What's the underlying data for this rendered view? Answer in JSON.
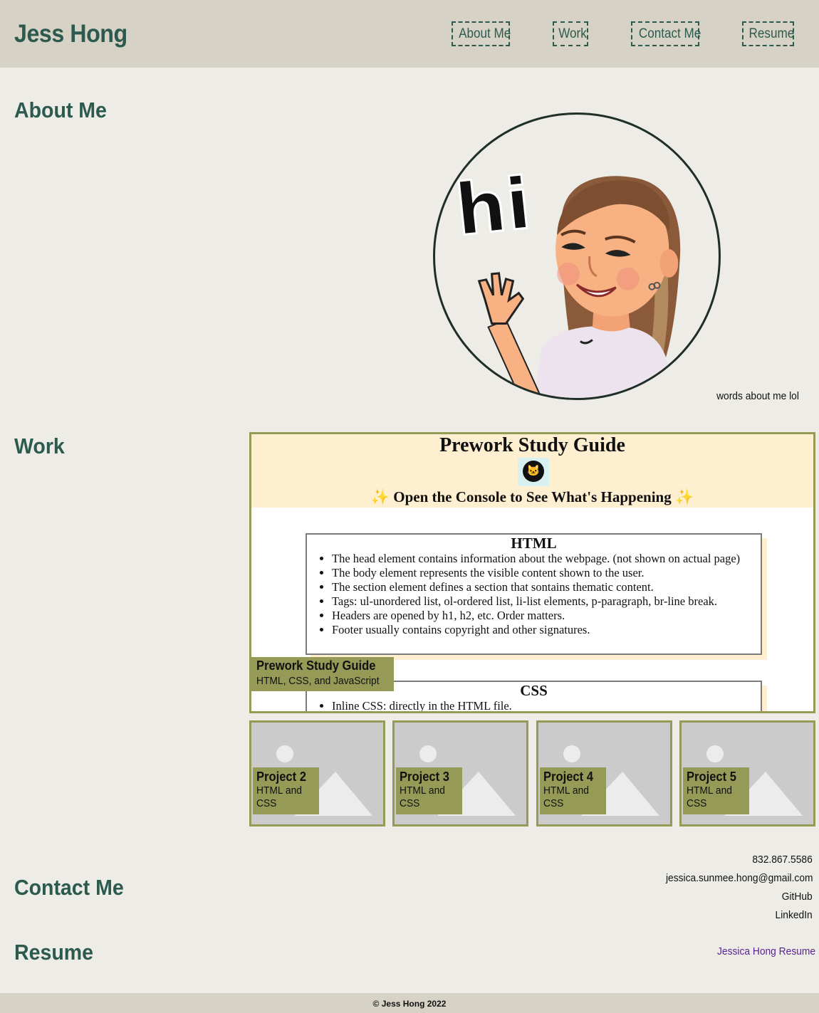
{
  "header": {
    "brand": "Jess Hong",
    "nav": [
      "About Me",
      "Work",
      "Contact Me",
      "Resume"
    ]
  },
  "about": {
    "title": "About Me",
    "avatar_icon": "waving-avatar-icon",
    "avatar_text": "hi",
    "text": "words about me lol"
  },
  "work": {
    "title": "Work",
    "featured": {
      "page_title": "Prework Study Guide",
      "subtitle": "✨ Open the Console to See What's Happening ✨",
      "html_card": {
        "heading": "HTML",
        "items": [
          "The head element contains information about the webpage. (not shown on actual page)",
          "The body element represents the visible content shown to the user.",
          "The section element defines a section that sontains thematic content.",
          "Tags: ul-unordered list, ol-ordered list, li-list elements, p-paragraph, br-line break.",
          "Headers are opened by h1, h2, etc. Order matters.",
          "Footer usually contains copyright and other signatures."
        ]
      },
      "css_card": {
        "heading": "CSS",
        "items": [
          "Inline CSS: directly in the HTML file."
        ]
      },
      "label_title": "Prework Study Guide",
      "label_sub": "HTML, CSS, and JavaScript"
    },
    "projects": [
      {
        "title": "Project 2",
        "sub": "HTML and CSS"
      },
      {
        "title": "Project 3",
        "sub": "HTML and CSS"
      },
      {
        "title": "Project 4",
        "sub": "HTML and CSS"
      },
      {
        "title": "Project 5",
        "sub": "HTML and CSS"
      }
    ]
  },
  "contact": {
    "title": "Contact Me",
    "phone": "832.867.5586",
    "email": "jessica.sunmee.hong@gmail.com",
    "github": "GitHub",
    "linkedin": "LinkedIn"
  },
  "resume": {
    "title": "Resume",
    "link": "Jessica Hong Resume"
  },
  "footer": {
    "text": "© Jess Hong 2022"
  },
  "colors": {
    "header_bg": "#d6d2c6",
    "page_bg": "#edece7",
    "accent": "#2d5a4e",
    "olive": "#969a57",
    "link_visited": "#5b1e8f"
  }
}
